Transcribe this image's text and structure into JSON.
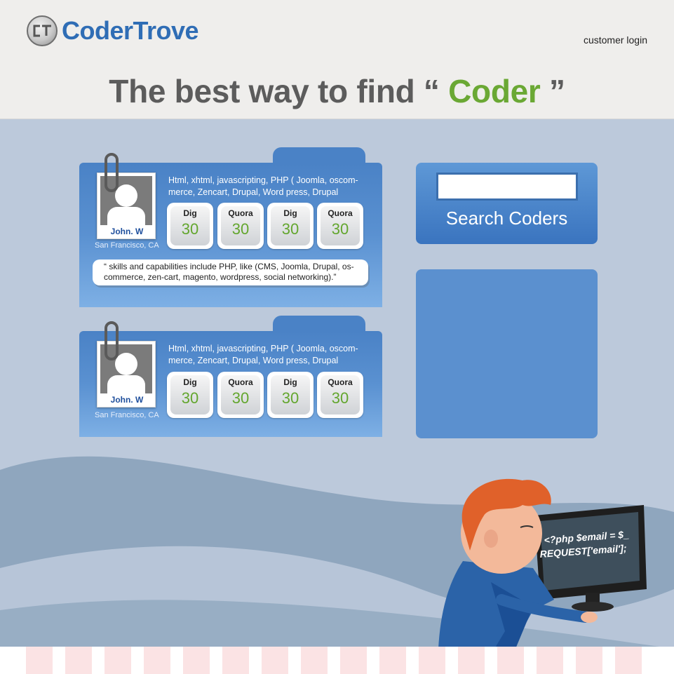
{
  "header": {
    "logo_text": "CoderTrove",
    "customer_login": "customer login",
    "hero_prefix": "The best way to find",
    "hero_open_quote": "“",
    "hero_accent": "Coder",
    "hero_close_quote": "”"
  },
  "cards": [
    {
      "name": "John. W",
      "location": "San Francisco, CA",
      "skills_line1": "Html, xhtml, javascripting, PHP ( Joomla, oscom-",
      "skills_line2": "merce, Zencart, Drupal, Word press, Drupal",
      "stats": [
        {
          "label": "Dig",
          "value": "30"
        },
        {
          "label": "Quora",
          "value": "30"
        },
        {
          "label": "Dig",
          "value": "30"
        },
        {
          "label": "Quora",
          "value": "30"
        }
      ],
      "quote_line1": "“ skills and capabilities include PHP, like (CMS, Joomla, Drupal, os-",
      "quote_line2": "commerce, zen-cart, magento, wordpress, social networking).”"
    },
    {
      "name": "John. W",
      "location": "San Francisco, CA",
      "skills_line1": "Html, xhtml, javascripting, PHP ( Joomla, oscom-",
      "skills_line2": "merce, Zencart, Drupal, Word press, Drupal",
      "stats": [
        {
          "label": "Dig",
          "value": "30"
        },
        {
          "label": "Quora",
          "value": "30"
        },
        {
          "label": "Dig",
          "value": "30"
        },
        {
          "label": "Quora",
          "value": "30"
        }
      ]
    }
  ],
  "search": {
    "value": "",
    "button_label": "Search Coders"
  },
  "illustration": {
    "code_line1": "<?php $email = $_",
    "code_line2": "REQUEST['email'];"
  },
  "colors": {
    "brand_blue": "#2f6db5",
    "accent_green": "#6aa834",
    "panel_blue": "#4a82c6",
    "background": "#bcc9db"
  },
  "icons": [
    "codertrove-logo-icon",
    "paperclip-icon",
    "user-avatar-icon"
  ]
}
